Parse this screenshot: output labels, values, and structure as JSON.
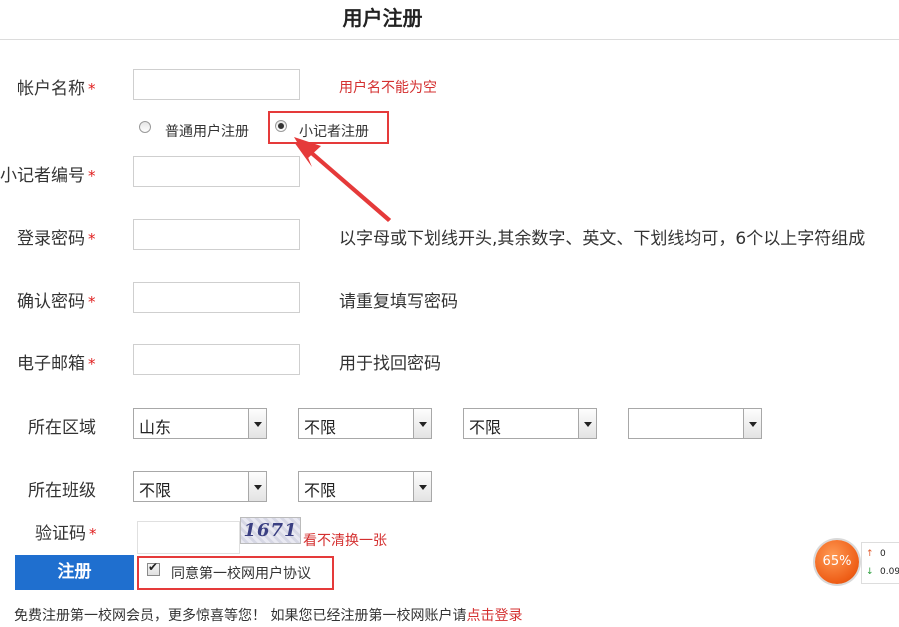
{
  "page": {
    "title": "用户注册"
  },
  "fields": {
    "username": {
      "label": "帐户名称",
      "value": "",
      "error": "用户名不能为空"
    },
    "reporter_no": {
      "label": "小记者编号",
      "value": ""
    },
    "password": {
      "label": "登录密码",
      "value": "",
      "hint": "以字母或下划线开头,其余数字、英文、下划线均可，6个以上字符组成"
    },
    "confirm": {
      "label": "确认密码",
      "value": "",
      "hint": "请重复填写密码"
    },
    "email": {
      "label": "电子邮箱",
      "value": "",
      "hint": "用于找回密码"
    },
    "region": {
      "label": "所在区域",
      "selects": [
        "山东",
        "不限",
        "不限",
        ""
      ]
    },
    "class": {
      "label": "所在班级",
      "selects": [
        "不限",
        "不限"
      ]
    },
    "captcha": {
      "label": "验证码",
      "value": "",
      "image_text": "1671",
      "refresh": "看不清换一张"
    }
  },
  "required_mark": "*",
  "register_type": {
    "options": [
      "普通用户注册",
      "小记者注册"
    ],
    "selected": "小记者注册"
  },
  "register_button": "注册",
  "agreement": {
    "label": "同意第一校网用户协议",
    "checked": true
  },
  "footer": {
    "text": "免费注册第一校网会员，更多惊喜等您！   如果您已经注册第一校网账户请",
    "link": "点击登录"
  },
  "widget": {
    "percent": "65%",
    "up_value": "0",
    "down_value": "0.09",
    "up_arrow": "↑",
    "down_arrow": "↓"
  },
  "colors": {
    "accent_blue": "#1f6fcf",
    "error_red": "#d43030",
    "highlight_red": "#e53a3a",
    "gauge_orange": "#ee5d16"
  }
}
